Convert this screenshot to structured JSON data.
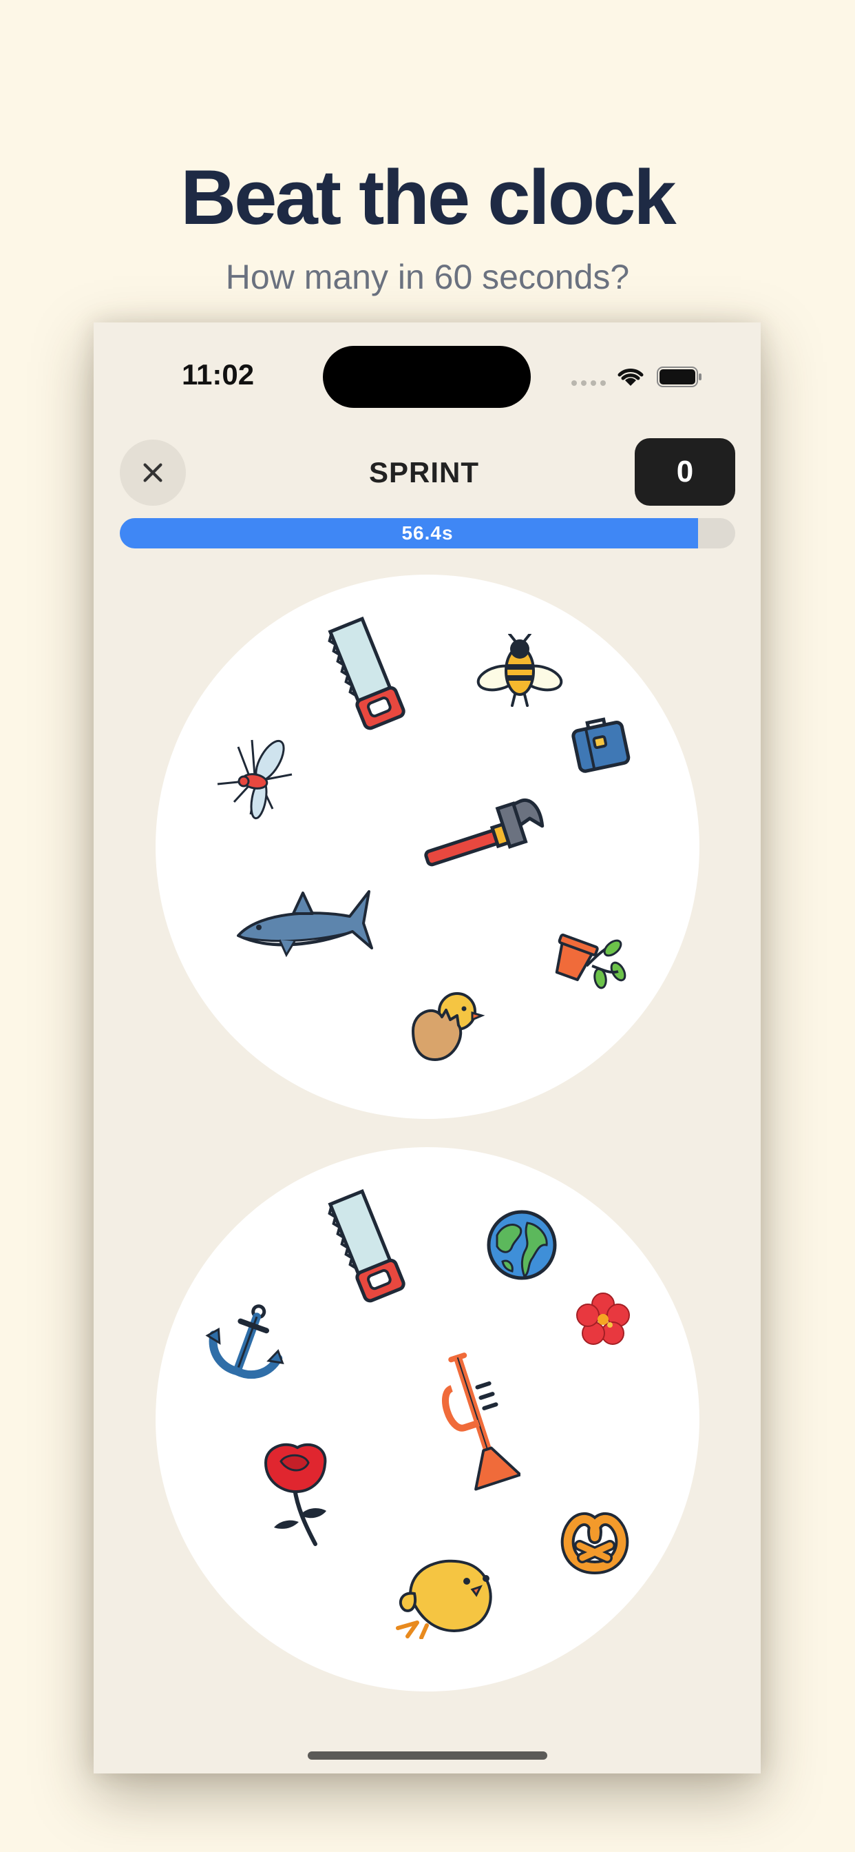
{
  "hero": {
    "title": "Beat the clock",
    "subtitle": "How many in 60 seconds?"
  },
  "status_bar": {
    "time": "11:02",
    "icons": [
      "cellular-signal-icon",
      "wifi-icon",
      "battery-icon"
    ]
  },
  "game_header": {
    "close_icon": "close-icon",
    "mode": "SPRINT",
    "score": "0"
  },
  "timer": {
    "label": "56.4s",
    "remaining_fraction": 0.94
  },
  "cards": {
    "top": {
      "symbols": [
        "saw-icon",
        "bee-icon",
        "mosquito-icon",
        "briefcase-icon",
        "hammer-icon",
        "shark-icon",
        "potted-plant-icon",
        "hatching-chick-icon"
      ]
    },
    "bottom": {
      "symbols": [
        "saw-icon",
        "earth-globe-icon",
        "anchor-icon",
        "hibiscus-icon",
        "trumpet-icon",
        "rose-icon",
        "pretzel-icon",
        "chick-icon"
      ]
    }
  },
  "colors": {
    "background": "#fdf7e7",
    "title": "#1e2a44",
    "timer_fill": "#3f87f5",
    "score_badge": "#1f1f1f"
  }
}
